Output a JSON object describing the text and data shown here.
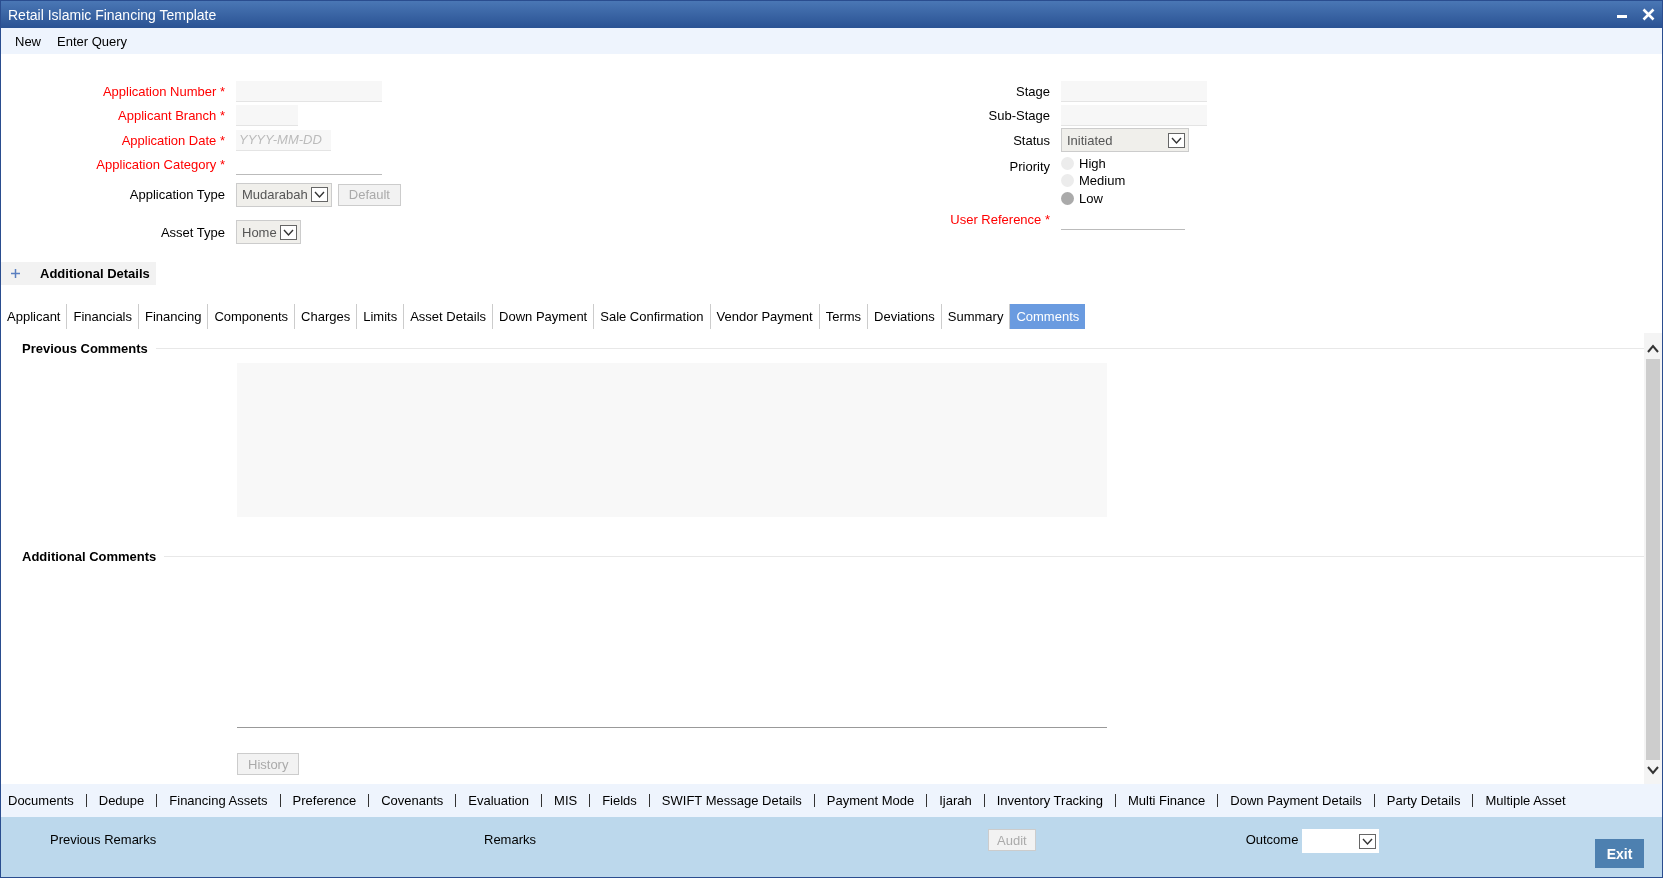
{
  "window": {
    "title": "Retail Islamic Financing Template"
  },
  "toolbar": [
    "New",
    "Enter Query"
  ],
  "left_fields": [
    {
      "kind": "text",
      "label": "Application Number *",
      "required": true
    },
    {
      "kind": "text",
      "label": "Applicant Branch *",
      "required": true,
      "short": true
    },
    {
      "kind": "date",
      "label": "Application Date *",
      "required": true,
      "placeholder": "YYYY-MM-DD"
    },
    {
      "kind": "line",
      "label": "Application Category *",
      "required": true
    },
    {
      "kind": "select",
      "label": "Application Type",
      "required": false,
      "value": "Mudarabah",
      "button": "Default"
    },
    {
      "kind": "select",
      "label": "Asset Type",
      "required": false,
      "value": "Home"
    }
  ],
  "right_fields": [
    {
      "kind": "text",
      "label": "Stage",
      "required": false
    },
    {
      "kind": "text",
      "label": "Sub-Stage",
      "required": false
    },
    {
      "kind": "select",
      "label": "Status",
      "required": false,
      "value": "Initiated"
    },
    {
      "kind": "radio",
      "label": "Priority",
      "required": false,
      "options": [
        {
          "label": "High",
          "selected": false
        },
        {
          "label": "Medium",
          "selected": false
        },
        {
          "label": "Low",
          "selected": true
        }
      ]
    },
    {
      "kind": "line",
      "label": "User Reference *",
      "required": true
    }
  ],
  "additional_details": {
    "label": "Additional Details",
    "expanded": false
  },
  "tabs": [
    {
      "label": "Applicant",
      "selected": false
    },
    {
      "label": "Financials",
      "selected": false
    },
    {
      "label": "Financing",
      "selected": false
    },
    {
      "label": "Components",
      "selected": false
    },
    {
      "label": "Charges",
      "selected": false
    },
    {
      "label": "Limits",
      "selected": false
    },
    {
      "label": "Asset Details",
      "selected": false
    },
    {
      "label": "Down Payment",
      "selected": false
    },
    {
      "label": "Sale Confirmation",
      "selected": false
    },
    {
      "label": "Vendor Payment",
      "selected": false
    },
    {
      "label": "Terms",
      "selected": false
    },
    {
      "label": "Deviations",
      "selected": false
    },
    {
      "label": "Summary",
      "selected": false
    },
    {
      "label": "Comments",
      "selected": true
    }
  ],
  "sections": {
    "previous": "Previous Comments",
    "additional": "Additional Comments",
    "history_button": "History"
  },
  "links": [
    "Documents",
    "Dedupe",
    "Financing Assets",
    "Preference",
    "Covenants",
    "Evaluation",
    "MIS",
    "Fields",
    "SWIFT Message Details",
    "Payment Mode",
    "Ijarah",
    "Inventory Tracking",
    "Multi Finance",
    "Down Payment Details",
    "Party Details",
    "Multiple Asset"
  ],
  "footer": {
    "previous_remarks": "Previous Remarks",
    "remarks": "Remarks",
    "audit_button": "Audit",
    "outcome_label": "Outcome",
    "exit_button": "Exit"
  }
}
